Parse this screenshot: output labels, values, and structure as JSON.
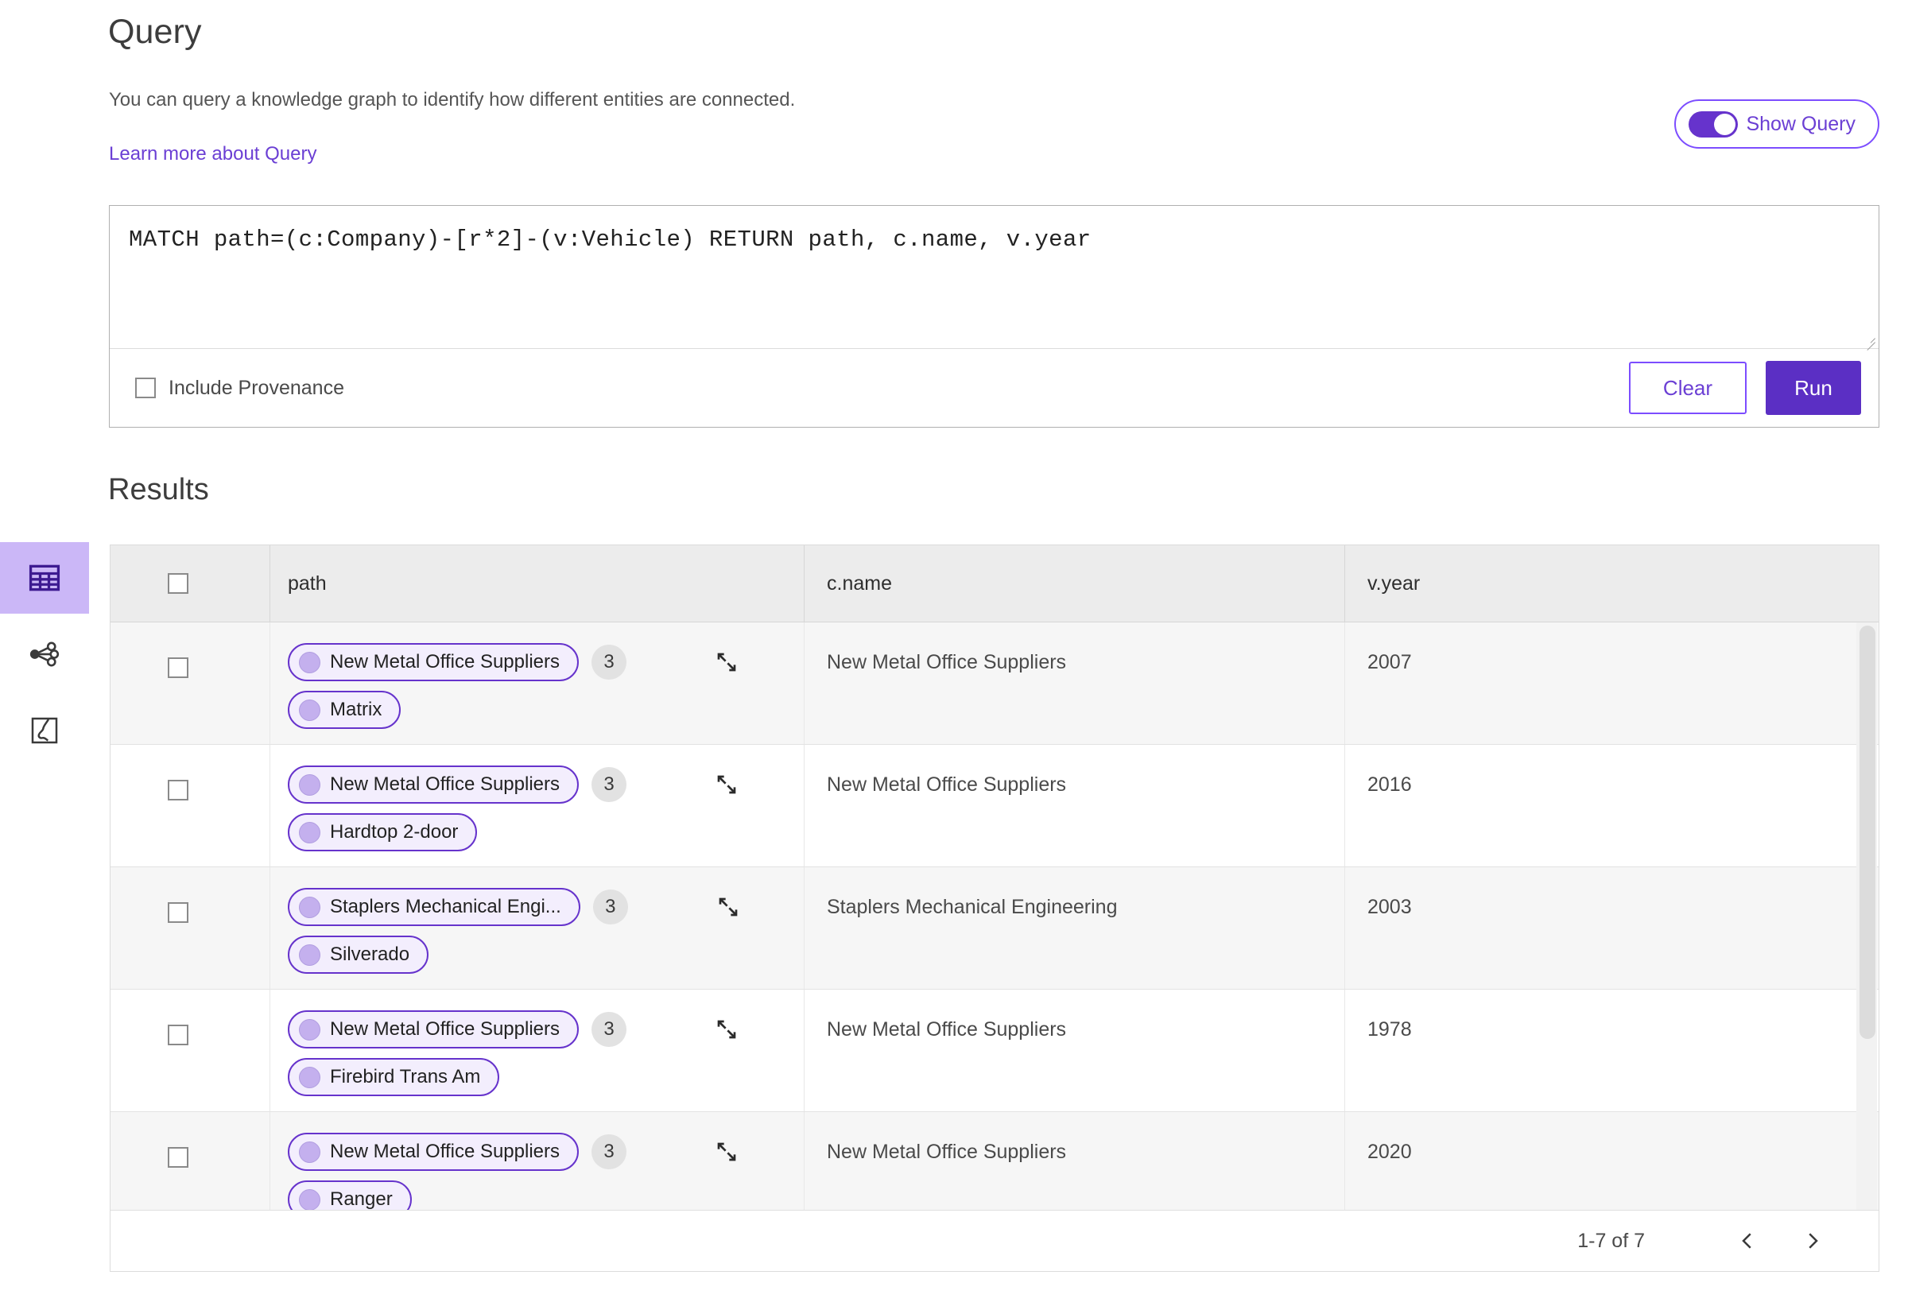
{
  "header": {
    "title": "Query",
    "subtitle": "You can query a knowledge graph to identify how different entities are connected.",
    "learn_more_link": "Learn more about Query"
  },
  "show_query_toggle": {
    "label": "Show Query",
    "state": "on",
    "accent_color": "#6633cc"
  },
  "editor": {
    "query_text": "MATCH path=(c:Company)-[r*2]-(v:Vehicle) RETURN path, c.name, v.year",
    "include_provenance_label": "Include Provenance",
    "include_provenance_checked": false,
    "clear_label": "Clear",
    "run_label": "Run"
  },
  "results": {
    "heading": "Results",
    "columns": [
      "path",
      "c.name",
      "v.year"
    ],
    "rows": [
      {
        "chips": [
          "New Metal Office Suppliers",
          "Matrix"
        ],
        "count": "3",
        "c_name": "New Metal Office Suppliers",
        "v_year": "2007"
      },
      {
        "chips": [
          "New Metal Office Suppliers",
          "Hardtop 2-door"
        ],
        "count": "3",
        "c_name": "New Metal Office Suppliers",
        "v_year": "2016"
      },
      {
        "chips": [
          "Staplers Mechanical Engi...",
          "Silverado"
        ],
        "count": "3",
        "c_name": "Staplers Mechanical Engineering",
        "v_year": "2003"
      },
      {
        "chips": [
          "New Metal Office Suppliers",
          "Firebird Trans Am"
        ],
        "count": "3",
        "c_name": "New Metal Office Suppliers",
        "v_year": "1978"
      },
      {
        "chips": [
          "New Metal Office Suppliers",
          "Ranger"
        ],
        "count": "3",
        "c_name": "New Metal Office Suppliers",
        "v_year": "2020"
      }
    ],
    "pagination": {
      "range_label": "1-7 of 7",
      "prev_icon": "chevron-left-icon",
      "next_icon": "chevron-right-icon"
    }
  },
  "sidebar": {
    "items": [
      {
        "icon": "table-view-icon",
        "active": true
      },
      {
        "icon": "graph-view-icon",
        "active": false
      },
      {
        "icon": "map-view-icon",
        "active": false
      }
    ],
    "active_color": "#cbb7f7"
  }
}
